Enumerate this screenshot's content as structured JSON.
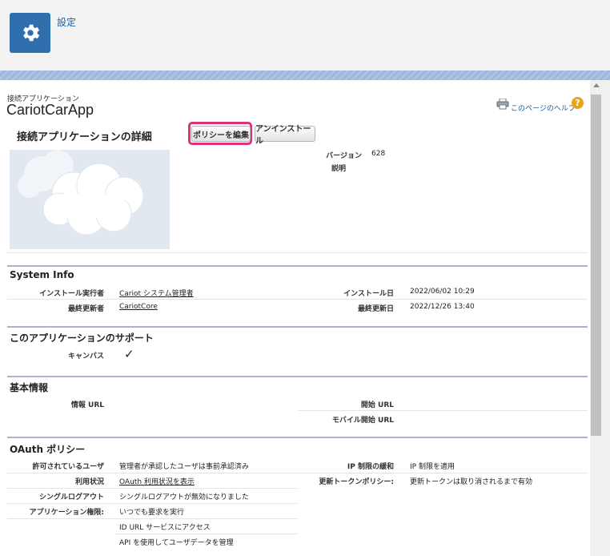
{
  "header": {
    "title": "設定",
    "icon": "gear-icon"
  },
  "page": {
    "breadcrumb": "接続アプリケーション",
    "app_name": "CariotCarApp",
    "help_link": "このページのヘルプ",
    "help_icon": "?"
  },
  "detail": {
    "title": "接続アプリケーションの詳細",
    "edit_policy_button": "ポリシーを編集",
    "uninstall_button": "アンインストール",
    "version_label": "バージョン",
    "version_value": "628",
    "description_label": "説明"
  },
  "system_info": {
    "title": "System Info",
    "installed_by_label": "インストール実行者",
    "installed_by_value": "Cariot システム管理者",
    "install_date_label": "インストール日",
    "install_date_value": "2022/06/02 10:29",
    "last_modified_by_label": "最終更新者",
    "last_modified_by_value": "CariotCore",
    "last_modified_date_label": "最終更新日",
    "last_modified_date_value": "2022/12/26 13:40"
  },
  "support": {
    "title": "このアプリケーションのサポート",
    "canvas_label": "キャンバス",
    "canvas_value": "✓"
  },
  "basic": {
    "title": "基本情報",
    "info_url_label": "情報 URL",
    "start_url_label": "開始 URL",
    "mobile_start_url_label": "モバイル開始 URL"
  },
  "oauth": {
    "title": "OAuth ポリシー",
    "permitted_users_label": "許可されているユーザ",
    "permitted_users_value": "管理者が承認したユーザは事前承認済み",
    "ip_relax_label": "IP 制限の緩和",
    "ip_relax_value": "IP 制限を適用",
    "usage_label": "利用状況",
    "usage_value": "OAuth 利用状況を表示",
    "refresh_policy_label": "更新トークンポリシー:",
    "refresh_policy_value": "更新トークンは取り消されるまで有効",
    "single_logout_label": "シングルログアウト",
    "single_logout_value": "シングルログアウトが無効になりました",
    "app_permissions_label": "アプリケーション権限:",
    "app_permissions": [
      "いつでも要求を実行",
      "ID URL サービスにアクセス",
      "API を使用してユーザデータを管理"
    ]
  }
}
